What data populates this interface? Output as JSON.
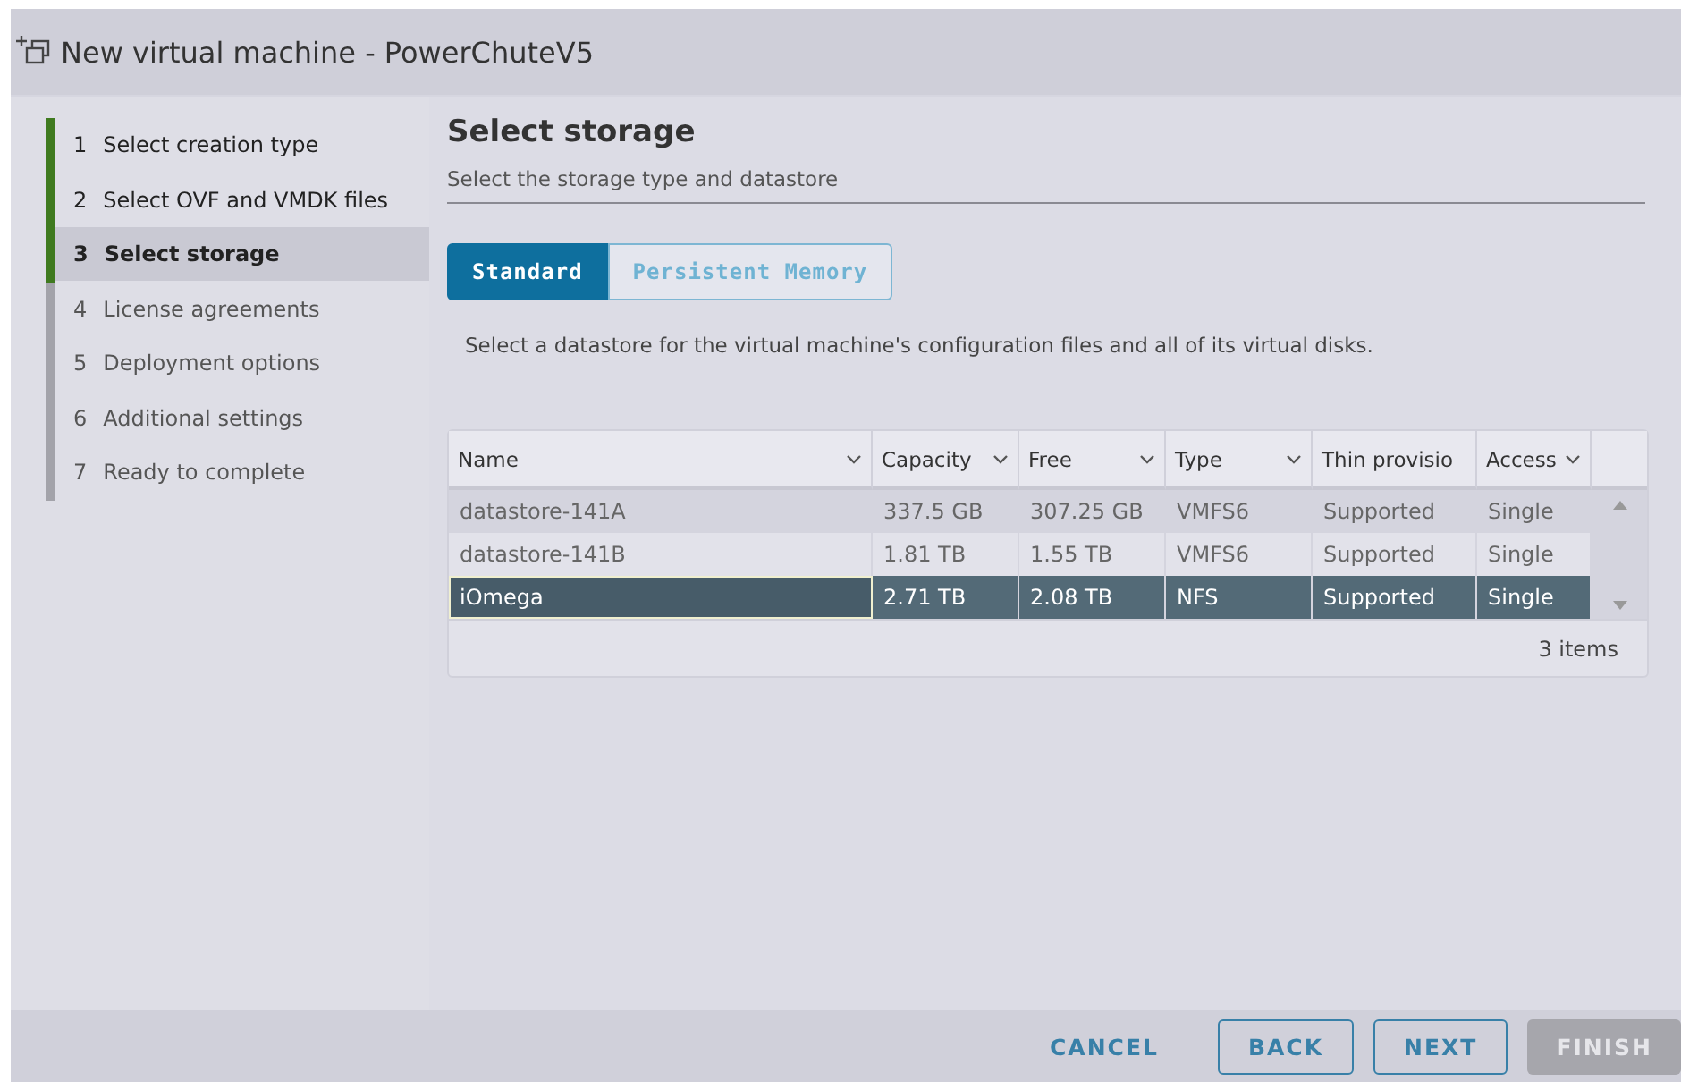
{
  "window": {
    "title": "New virtual machine - PowerChuteV5"
  },
  "steps": [
    {
      "number": "1",
      "label": "Select creation type",
      "completed": true,
      "selected": false
    },
    {
      "number": "2",
      "label": "Select OVF and VMDK files",
      "completed": true,
      "selected": false
    },
    {
      "number": "3",
      "label": "Select storage",
      "completed": false,
      "selected": true
    },
    {
      "number": "4",
      "label": "License agreements",
      "completed": false,
      "selected": false
    },
    {
      "number": "5",
      "label": "Deployment options",
      "completed": false,
      "selected": false
    },
    {
      "number": "6",
      "label": "Additional settings",
      "completed": false,
      "selected": false
    },
    {
      "number": "7",
      "label": "Ready to complete",
      "completed": false,
      "selected": false
    }
  ],
  "page": {
    "title": "Select storage",
    "subtitle": "Select the storage type and datastore"
  },
  "storage_tabs": [
    {
      "label": "Standard",
      "selected": true
    },
    {
      "label": "Persistent Memory",
      "selected": false
    }
  ],
  "instruction": "Select a datastore for the virtual machine's configuration files and all of its virtual disks.",
  "table": {
    "columns": [
      "Name",
      "Capacity",
      "Free",
      "Type",
      "Thin provisio",
      "Access"
    ],
    "rows": [
      {
        "cells": [
          "datastore-141A",
          "337.5 GB",
          "307.25 GB",
          "VMFS6",
          "Supported",
          "Single"
        ],
        "selected": false
      },
      {
        "cells": [
          "datastore-141B",
          "1.81 TB",
          "1.55 TB",
          "VMFS6",
          "Supported",
          "Single"
        ],
        "selected": false
      },
      {
        "cells": [
          "iOmega",
          "2.71 TB",
          "2.08 TB",
          "NFS",
          "Supported",
          "Single"
        ],
        "selected": true
      }
    ],
    "footer": "3 items"
  },
  "buttons": [
    {
      "label": "CANCEL",
      "kind": "flat",
      "disabled": false
    },
    {
      "label": "BACK",
      "kind": "outline",
      "disabled": false
    },
    {
      "label": "NEXT",
      "kind": "outline",
      "disabled": false
    },
    {
      "label": "FINISH",
      "kind": "solid",
      "disabled": true
    }
  ]
}
